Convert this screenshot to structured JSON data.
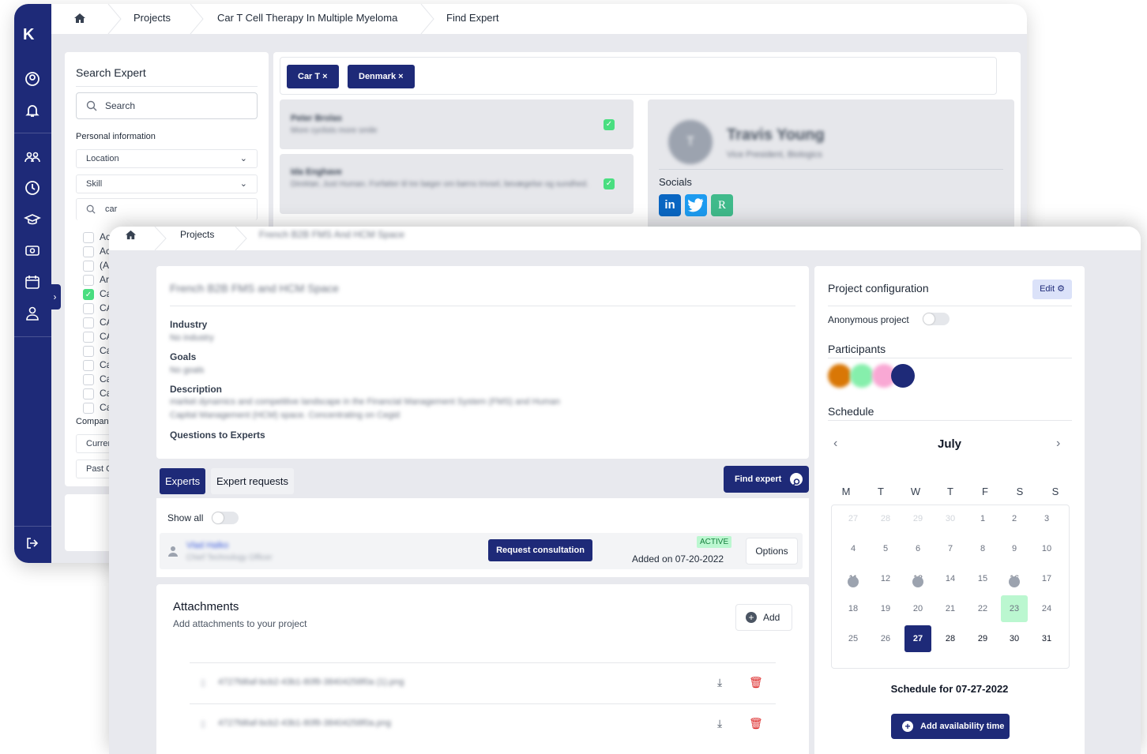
{
  "back": {
    "breadcrumb": [
      "Projects",
      "Car T Cell Therapy In Multiple Myeloma",
      "Find Expert"
    ],
    "search_panel": {
      "title": "Search Expert",
      "search_placeholder": "Search",
      "personal_info": "Personal information",
      "location": "Location",
      "skill": "Skill",
      "skill_query": "car",
      "skill_options": [
        "Ac",
        "Ac",
        "(A",
        "Ar",
        "Ca",
        "CA",
        "CA",
        "CA",
        "Ca",
        "Ca",
        "Ca",
        "Ca",
        "Ca"
      ],
      "company_label": "Compan",
      "current": "Curren",
      "past": "Past C"
    },
    "chips": [
      "Car T ×",
      "Denmark ×"
    ],
    "experts": [
      {
        "name": "Peter Brolas",
        "bio": "More cyclists more smile"
      },
      {
        "name": "Ida Enghave",
        "bio": "Direktør, Just Human. Forfatter til tre bøger om børns trivsel, bevægelse og sundhed."
      }
    ],
    "profile": {
      "initial": "T",
      "name": "Travis Young",
      "title": "Vice President, Biologics",
      "socials_label": "Socials",
      "socials": [
        "in",
        "t",
        "R"
      ]
    }
  },
  "front": {
    "breadcrumb": [
      "Projects",
      "French B2B FMS And HCM Space"
    ],
    "project": {
      "title": "French B2B FMS and HCM Space",
      "industry_label": "Industry",
      "industry_value": "No industry",
      "goals_label": "Goals",
      "goals_value": "No goals",
      "description_label": "Description",
      "description_value": "market dynamics and competitive landscape in the Financial Management System (FMS) and Human Capital Management (HCM) space. Concentrating on Cegid",
      "questions_label": "Questions to Experts"
    },
    "tabs": {
      "experts": "Experts",
      "requests": "Expert requests",
      "find_expert": "Find expert"
    },
    "show_all": "Show all",
    "expert_row": {
      "name": "Vlad Halko",
      "role": "Chief Technology Officer",
      "request_btn": "Request consultation",
      "status": "ACTIVE",
      "added": "Added on 07-20-2022",
      "options": "Options"
    },
    "attachments": {
      "title": "Attachments",
      "subtitle": "Add attachments to your project",
      "add": "Add",
      "files": [
        "4727fd6af-bcb2-43b1-80f8-38404258f0a (1).png",
        "4727fd6af-bcb2-43b1-80f8-38404258f0a.png"
      ]
    },
    "config": {
      "title": "Project configuration",
      "edit": "Edit ⚙",
      "anonymous": "Anonymous project",
      "participants": "Participants",
      "schedule": "Schedule",
      "month": "July",
      "weekdays": [
        "M",
        "T",
        "W",
        "T",
        "F",
        "S",
        "S"
      ],
      "weeks": [
        [
          "27",
          "28",
          "29",
          "30",
          "1",
          "2",
          "3"
        ],
        [
          "4",
          "5",
          "6",
          "7",
          "8",
          "9",
          "10"
        ],
        [
          "11",
          "12",
          "13",
          "14",
          "15",
          "16",
          "17"
        ],
        [
          "18",
          "19",
          "20",
          "21",
          "22",
          "23",
          "24"
        ],
        [
          "25",
          "26",
          "27",
          "28",
          "29",
          "30",
          "31"
        ]
      ],
      "selected_day": "27",
      "highlighted_day": "23",
      "schedule_for": "Schedule for 07-27-2022",
      "add_availability": "Add availability time"
    }
  }
}
